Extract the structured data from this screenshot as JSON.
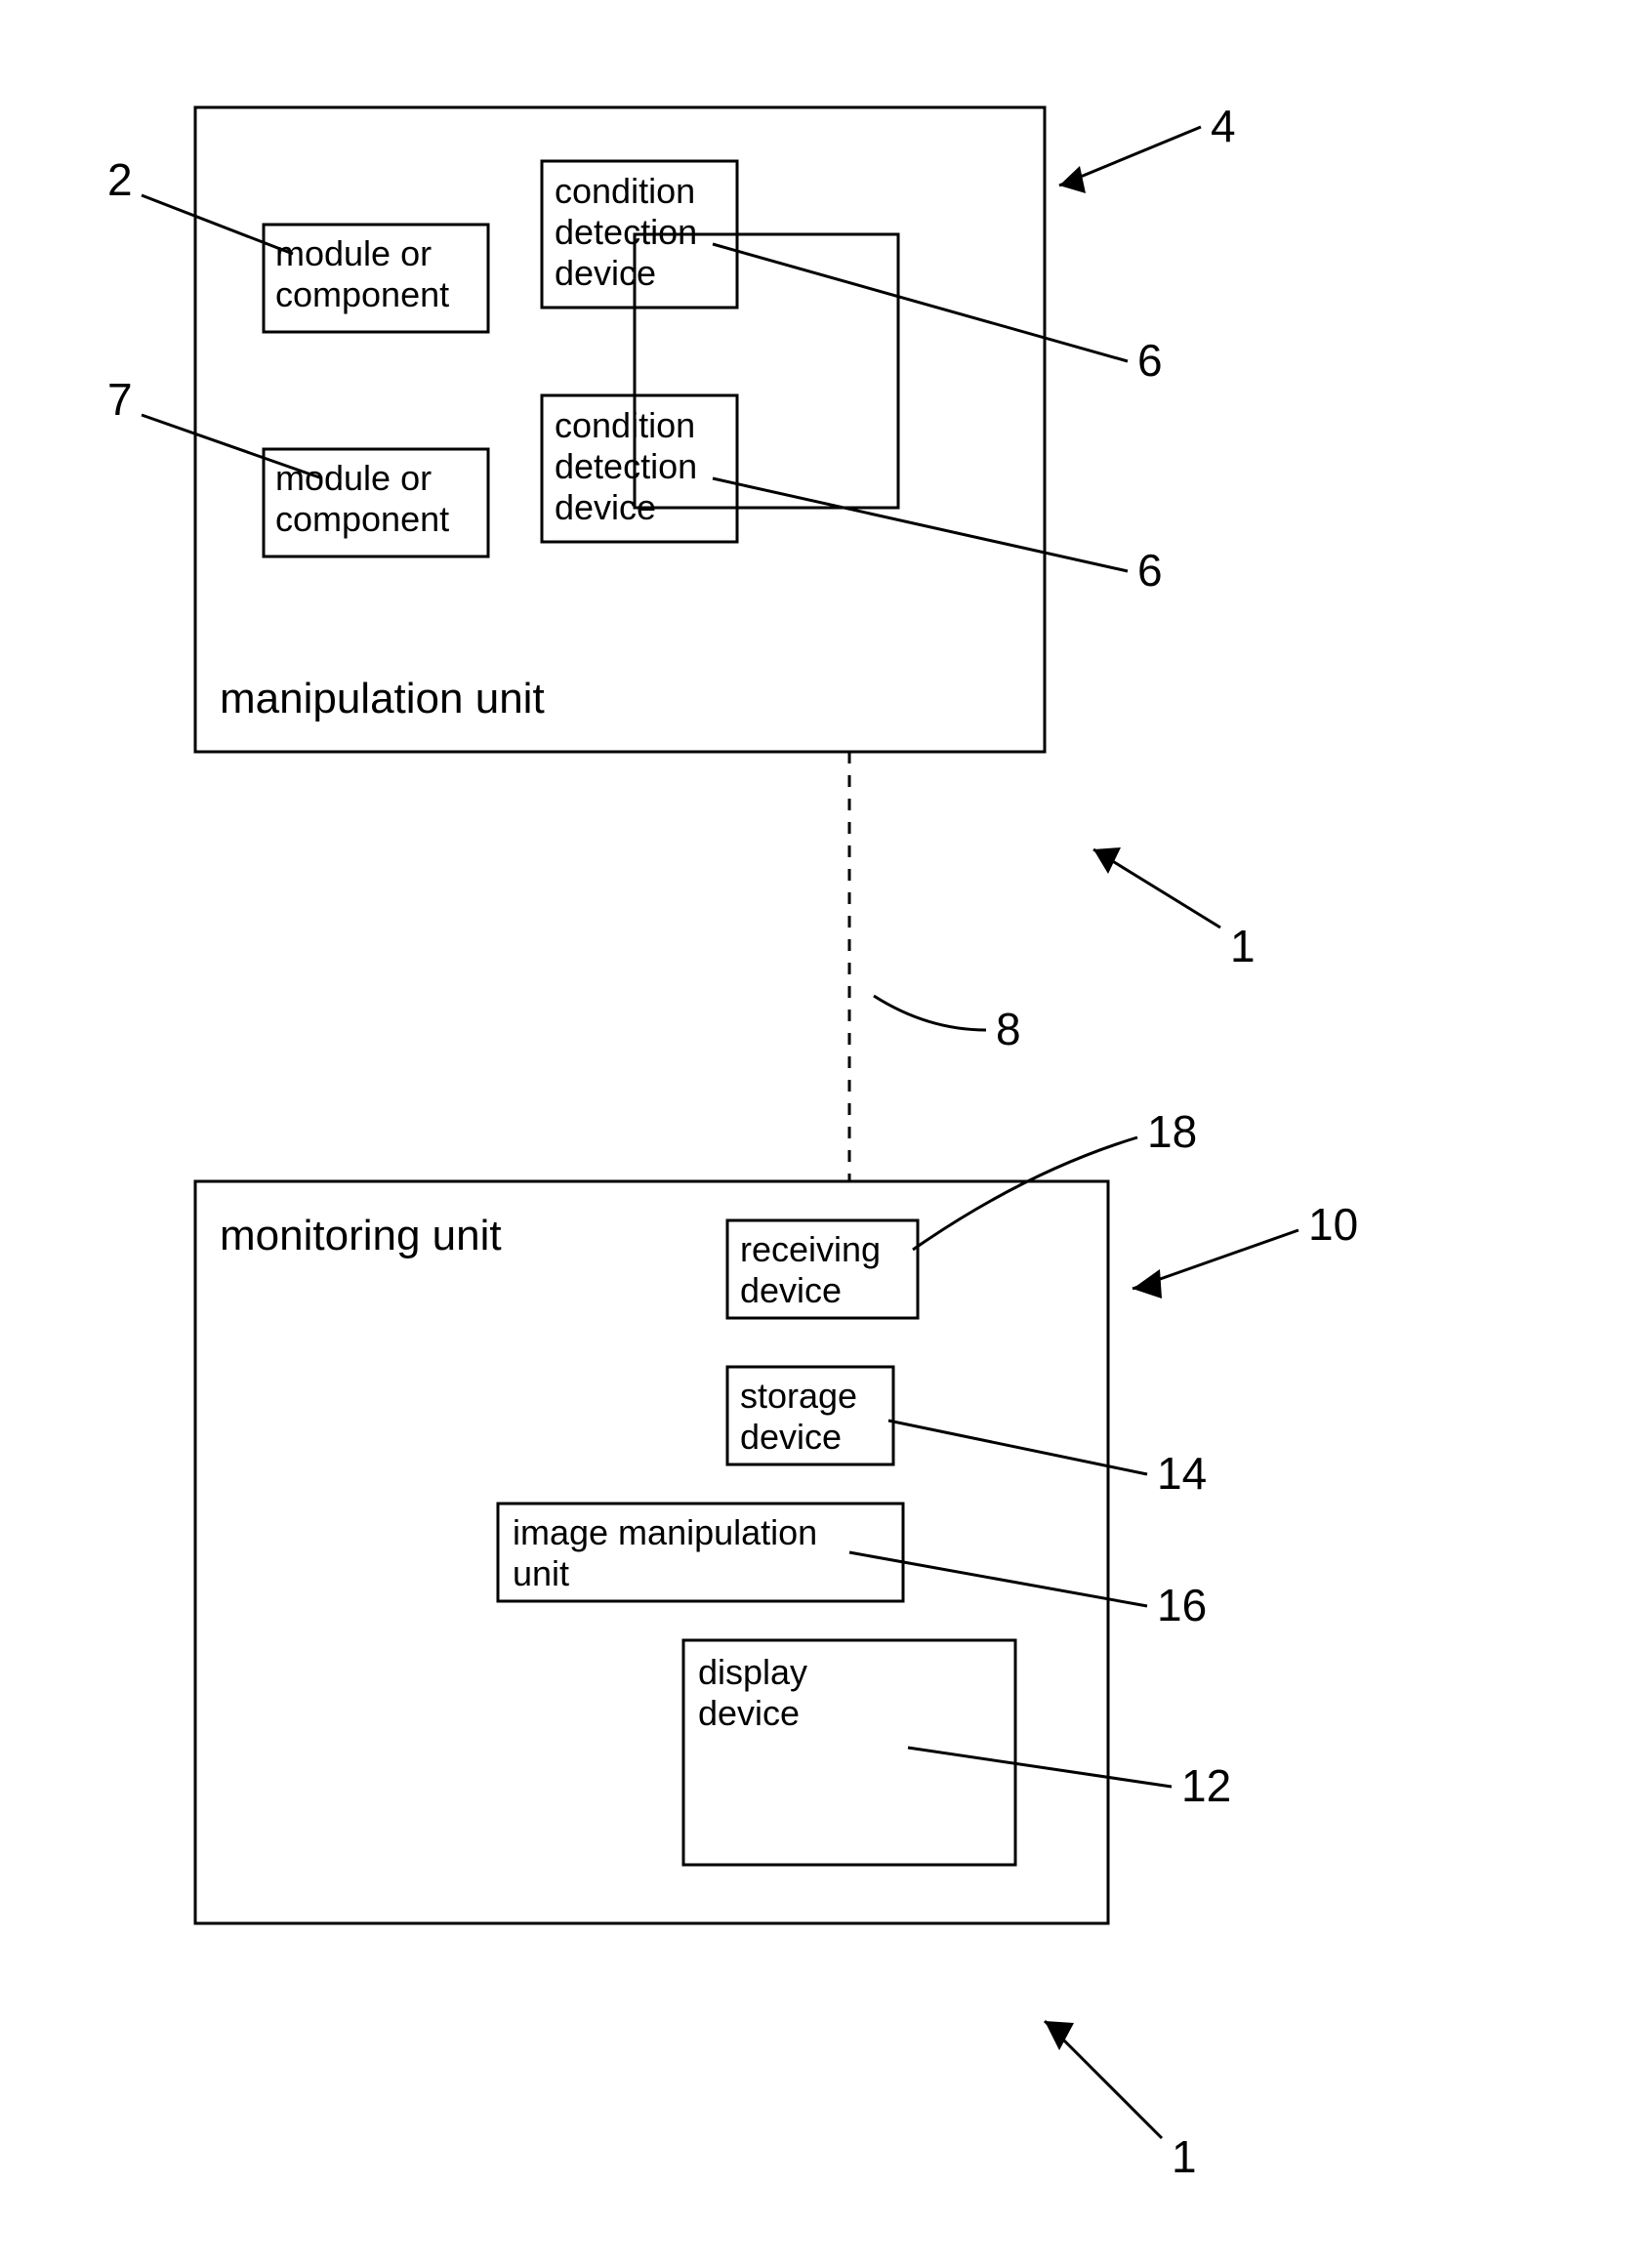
{
  "diagram": {
    "manipulation_unit": {
      "label": "manipulation unit",
      "module1": "module or component",
      "module2": "module or component",
      "cdd1": "condition detection device",
      "cdd2": "condition detection device"
    },
    "monitoring_unit": {
      "label": "monitoring unit",
      "receiving": "receiving device",
      "storage": "storage device",
      "image_manip": "image manipulation unit",
      "display": "display device"
    },
    "callouts": {
      "c2": "2",
      "c4": "4",
      "c6a": "6",
      "c6b": "6",
      "c7": "7",
      "c1a": "1",
      "c8": "8",
      "c18": "18",
      "c10": "10",
      "c14": "14",
      "c16": "16",
      "c12": "12",
      "c1b": "1"
    }
  }
}
